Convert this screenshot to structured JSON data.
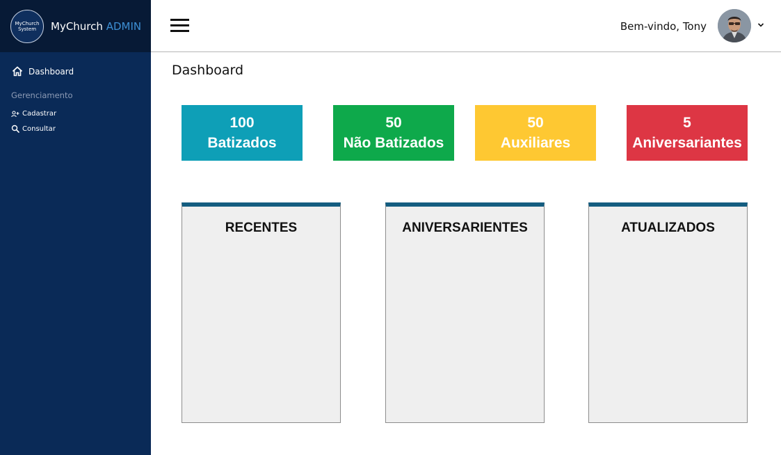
{
  "brand": {
    "logo_line1": "MyChurch",
    "logo_line2": "System",
    "name": "MyChurch",
    "name_accent": "ADMIN"
  },
  "sidebar": {
    "dashboard_label": "Dashboard",
    "section_title": "Gerenciamento",
    "items": [
      {
        "label": "Cadastrar",
        "icon": "user-plus-icon"
      },
      {
        "label": "Consultar",
        "icon": "search-icon"
      }
    ]
  },
  "header": {
    "welcome": "Bem-vindo, Tony"
  },
  "main": {
    "title": "Dashboard",
    "stats": [
      {
        "value": "100",
        "label": "Batizados",
        "color": "#0e9fb7"
      },
      {
        "value": "50",
        "label": "Não Batizados",
        "color": "#0ea94b"
      },
      {
        "value": "50",
        "label": "Auxiliares",
        "color": "#fec832"
      },
      {
        "value": "5",
        "label": "Aniversariantes",
        "color": "#dd3644"
      }
    ],
    "panels": [
      {
        "title": "RECENTES"
      },
      {
        "title": "ANIVERSARIENTES"
      },
      {
        "title": "ATUALIZADOS"
      }
    ]
  },
  "colors": {
    "sidebar_bg": "#0a2a57",
    "brand_bg": "#071a36",
    "panel_accent": "#145d80",
    "admin_accent": "#3d8fd4"
  }
}
